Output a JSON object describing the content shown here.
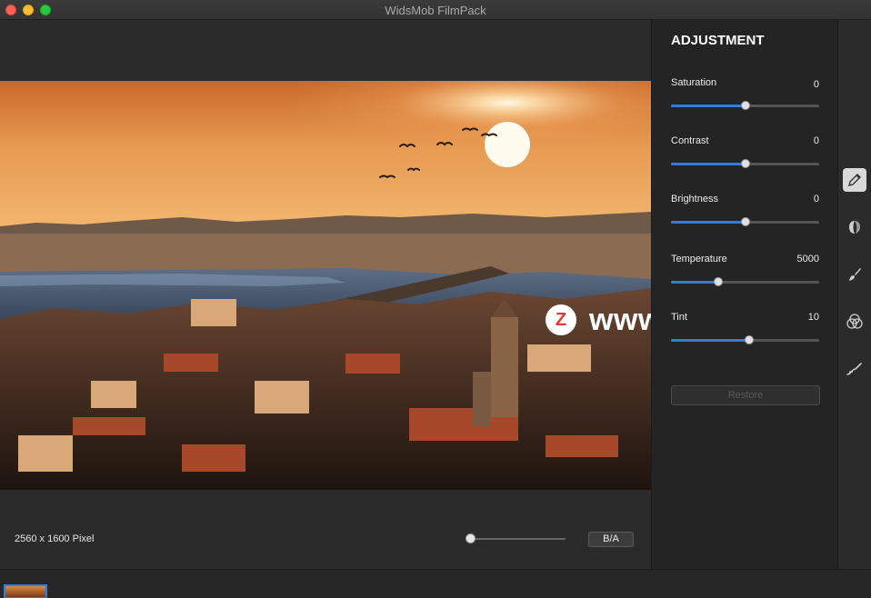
{
  "window": {
    "title": "WidsMob FilmPack"
  },
  "canvas": {
    "image_size": "2560 x 1600 Pixel",
    "ba_label": "B/A"
  },
  "adjustment": {
    "title": "ADJUSTMENT",
    "sliders": [
      {
        "label": "Saturation",
        "value": "0",
        "level": 0.5
      },
      {
        "label": "Contrast",
        "value": "0",
        "level": 0.5
      },
      {
        "label": "Brightness",
        "value": "0",
        "level": 0.5
      },
      {
        "label": "Temperature",
        "value": "5000",
        "level": 0.32
      },
      {
        "label": "Tint",
        "value": "10",
        "level": 0.53
      }
    ],
    "restore_label": "Restore"
  },
  "toolbar": {
    "tools": [
      {
        "icon": "pencil-icon",
        "active": true
      },
      {
        "icon": "film-roll-icon",
        "active": false
      },
      {
        "icon": "brush-icon",
        "active": false
      },
      {
        "icon": "color-circles-icon",
        "active": false
      },
      {
        "icon": "leak-icon",
        "active": false
      }
    ]
  },
  "watermark": {
    "badge": "Z",
    "text": "www.MacZ.com"
  },
  "colors": {
    "accent": "#2f7de1",
    "panel": "#242424",
    "background": "#2b2b2b"
  }
}
